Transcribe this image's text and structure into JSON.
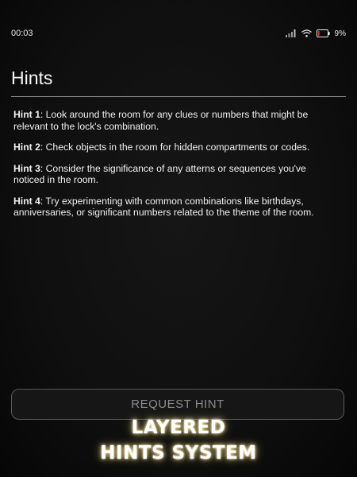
{
  "status_bar": {
    "time": "00:03",
    "battery_percent": "9%",
    "icons": [
      "signal-icon",
      "wifi-icon",
      "battery-icon"
    ]
  },
  "header": {
    "title": "Hints"
  },
  "hints": [
    {
      "label": "Hint 1",
      "text": ": Look around the room for any clues or numbers that might be relevant to the lock's combination."
    },
    {
      "label": "Hint 2",
      "text": ": Check objects in the room for hidden compartments or codes."
    },
    {
      "label": "Hint 3",
      "text": ": Consider the significance of any atterns or sequences you've noticed in the room."
    },
    {
      "label": "Hint 4",
      "text": ": Try experimenting with common combinations like birthdays, anniversaries, or significant numbers related to the theme of the room."
    }
  ],
  "actions": {
    "request_hint_label": "REQUEST HINT"
  },
  "overlay": {
    "line1": "LAYERED",
    "line2": "HINTS SYSTEM"
  },
  "colors": {
    "background": "#0d0d0d",
    "text": "#f0f0f0",
    "button_text": "#8c8c8c",
    "button_border": "#5a5a5a",
    "caption_glow": "#ffe8a0"
  }
}
